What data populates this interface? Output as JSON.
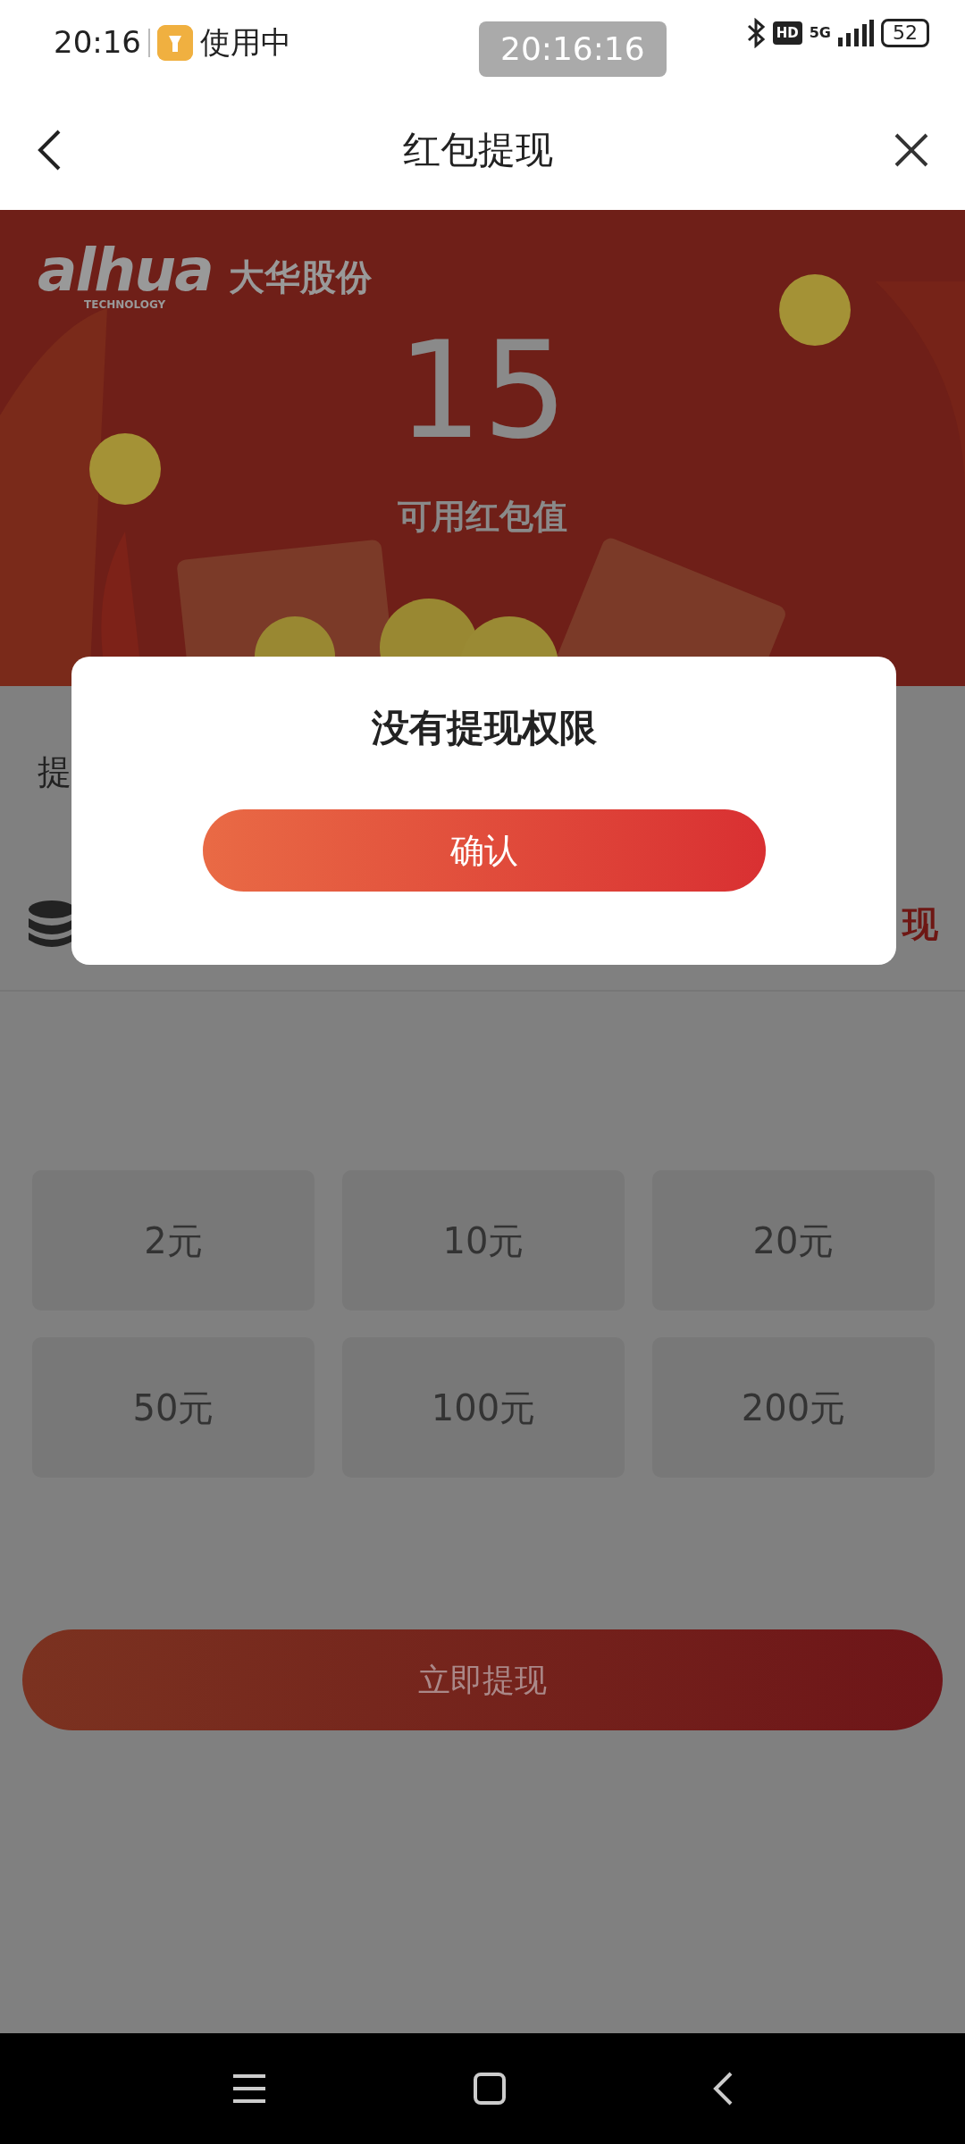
{
  "status_bar": {
    "time": "20:16",
    "app_status": "使用中",
    "clock_badge": "20:16:16",
    "hd": "HD",
    "network": "5G",
    "battery": "52"
  },
  "header": {
    "title": "红包提现"
  },
  "banner": {
    "brand": "alhua",
    "brand_sub": "TECHNOLOGY",
    "company": "大华股份",
    "amount": "15",
    "amount_label": "可用红包值"
  },
  "withdraw_row": {
    "label": "提"
  },
  "account_row": {
    "action": "现"
  },
  "amounts": [
    {
      "label": "2元",
      "selected": false
    },
    {
      "label": "10元",
      "selected": false
    },
    {
      "label": "20元",
      "selected": false
    },
    {
      "label": "50元",
      "selected": false
    },
    {
      "label": "100元",
      "selected": false
    },
    {
      "label": "200元",
      "selected": false
    }
  ],
  "submit": {
    "label": "立即提现"
  },
  "dialog": {
    "title": "没有提现权限",
    "confirm": "确认"
  }
}
